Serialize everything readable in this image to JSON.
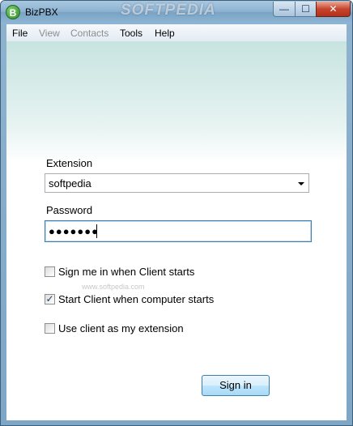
{
  "window": {
    "title": "BizPBX",
    "app_icon_letter": "B",
    "watermark": "SOFTPEDIA",
    "controls": {
      "minimize": "—",
      "maximize": "☐",
      "close": "✕"
    }
  },
  "menu": {
    "items": [
      {
        "label": "File",
        "enabled": true
      },
      {
        "label": "View",
        "enabled": false
      },
      {
        "label": "Contacts",
        "enabled": false
      },
      {
        "label": "Tools",
        "enabled": true
      },
      {
        "label": "Help",
        "enabled": true
      }
    ]
  },
  "form": {
    "extension_label": "Extension",
    "extension_value": "softpedia",
    "password_label": "Password",
    "password_value": "●●●●●●●",
    "options": [
      {
        "label": "Sign me in when Client starts",
        "checked": false
      },
      {
        "label": "Start Client when computer starts",
        "checked": true
      },
      {
        "label": "Use client as my extension",
        "checked": false
      }
    ],
    "checkmark": "✓",
    "faint_watermark": "www.softpedia.com",
    "signin_label": "Sign in"
  },
  "colors": {
    "accent_border": "#3c7fb1",
    "disabled_text": "#8d8d8d"
  }
}
